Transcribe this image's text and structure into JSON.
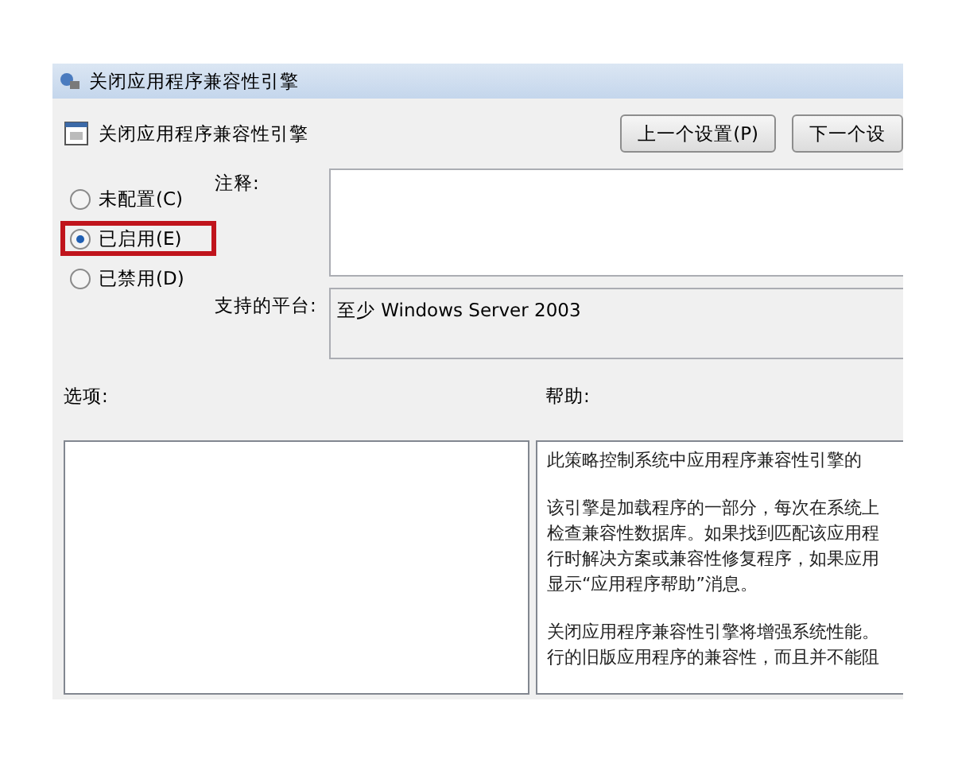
{
  "window": {
    "title": "关闭应用程序兼容性引擎"
  },
  "policy": {
    "name": "关闭应用程序兼容性引擎"
  },
  "nav_buttons": [
    "上一个设置(P)",
    "下一个设"
  ],
  "radios": [
    {
      "label": "未配置(C)",
      "selected": false,
      "highlighted": false
    },
    {
      "label": "已启用(E)",
      "selected": true,
      "highlighted": true
    },
    {
      "label": "已禁用(D)",
      "selected": false,
      "highlighted": false
    }
  ],
  "comment": {
    "label": "注释:"
  },
  "platform": {
    "label": "支持的平台:",
    "value": "至少 Windows Server 2003"
  },
  "options": {
    "label": "选项:"
  },
  "help": {
    "label": "帮助:",
    "paragraphs": [
      [
        "此策略控制系统中应用程序兼容性引擎的"
      ],
      [
        "该引擎是加载程序的一部分，每次在系统上",
        "检查兼容性数据库。如果找到匹配该应用程",
        "行时解决方案或兼容性修复程序，如果应用",
        "显示“应用程序帮助”消息。"
      ],
      [
        "关闭应用程序兼容性引擎将增强系统性能。",
        "行的旧版应用程序的兼容性，而且并不能阻"
      ]
    ]
  }
}
